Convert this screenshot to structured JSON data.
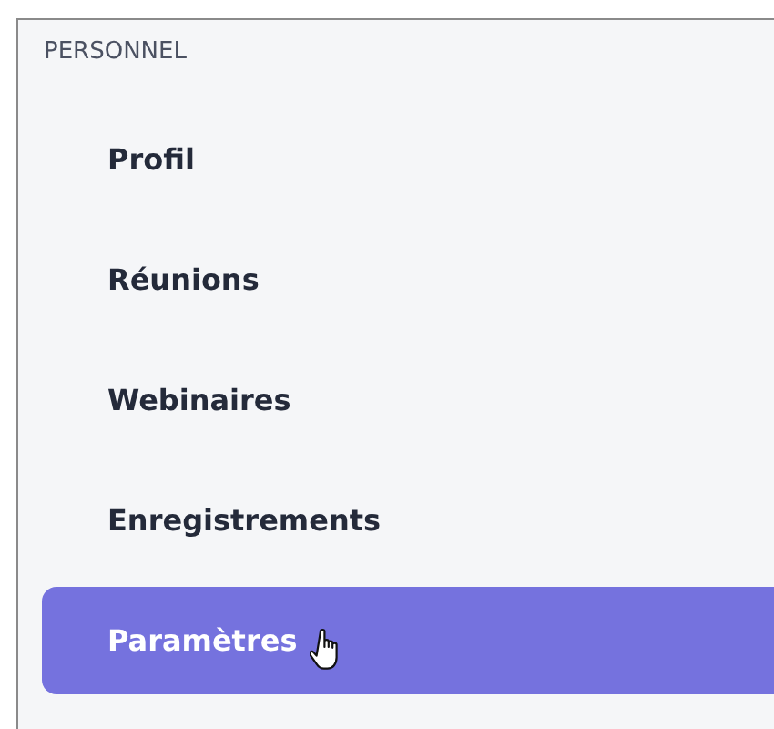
{
  "section": {
    "title": "PERSONNEL"
  },
  "items": [
    {
      "label": "Profil",
      "selected": false
    },
    {
      "label": "Réunions",
      "selected": false
    },
    {
      "label": "Webinaires",
      "selected": false
    },
    {
      "label": "Enregistrements",
      "selected": false
    },
    {
      "label": "Paramètres",
      "selected": true
    }
  ]
}
